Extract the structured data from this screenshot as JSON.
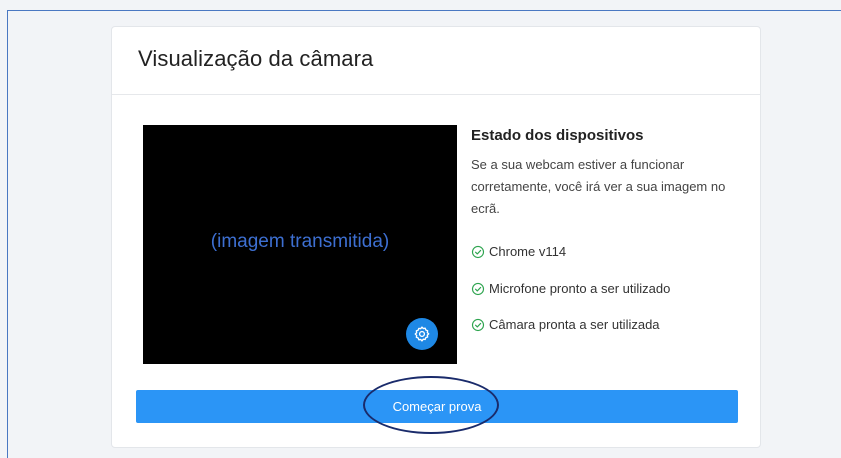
{
  "card": {
    "title": "Visualização da câmara"
  },
  "video": {
    "caption": "(imagem transmitida)",
    "settings_icon": "gear-icon"
  },
  "status": {
    "heading": "Estado dos dispositivos",
    "description": "Se a sua webcam estiver a funcionar corretamente, você irá ver a sua imagem no ecrã.",
    "items": [
      {
        "label": "Chrome v114",
        "icon": "check-circle-icon"
      },
      {
        "label": "Microfone pronto a ser utilizado",
        "icon": "check-circle-icon"
      },
      {
        "label": "Câmara pronta a ser utilizada",
        "icon": "check-circle-icon"
      }
    ]
  },
  "actions": {
    "start_label": "Começar prova"
  },
  "colors": {
    "primary": "#2b95f6",
    "success": "#2ea44f",
    "annotation": "#1a2b6b",
    "frame_border": "#4a78c2"
  }
}
